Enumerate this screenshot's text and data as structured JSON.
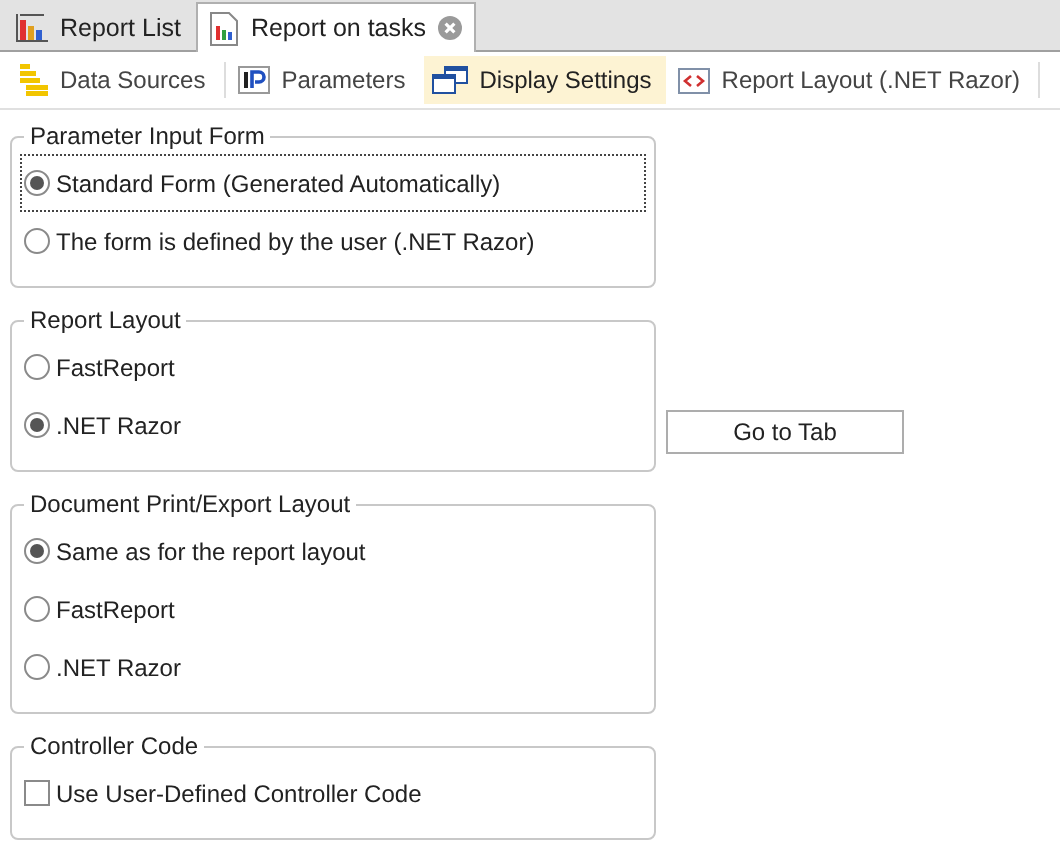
{
  "tabs": [
    {
      "label": "Report List",
      "kind": "list",
      "selected": false,
      "closable": false
    },
    {
      "label": "Report on tasks",
      "kind": "report",
      "selected": true,
      "closable": true
    }
  ],
  "toolbar": [
    {
      "label": "Data Sources",
      "kind": "data",
      "selected": false
    },
    {
      "label": "Parameters",
      "kind": "params",
      "selected": false
    },
    {
      "label": "Display Settings",
      "kind": "display",
      "selected": true
    },
    {
      "label": "Report Layout (.NET Razor)",
      "kind": "layout",
      "selected": false
    }
  ],
  "groups": [
    {
      "title": "Parameter Input Form",
      "options": [
        {
          "kind": "radio",
          "label": "Standard Form (Generated Automatically)",
          "selected": true,
          "focused": true
        },
        {
          "kind": "radio",
          "label": "The form is defined by the user (.NET Razor)",
          "selected": false,
          "focused": false
        }
      ]
    },
    {
      "title": "Report Layout",
      "action": "Go to Tab",
      "options": [
        {
          "kind": "radio",
          "label": "FastReport",
          "selected": false,
          "focused": false
        },
        {
          "kind": "radio",
          "label": ".NET Razor",
          "selected": true,
          "focused": false
        }
      ]
    },
    {
      "title": "Document Print/Export Layout",
      "options": [
        {
          "kind": "radio",
          "label": "Same as for the report layout",
          "selected": true,
          "focused": false
        },
        {
          "kind": "radio",
          "label": "FastReport",
          "selected": false,
          "focused": false
        },
        {
          "kind": "radio",
          "label": ".NET Razor",
          "selected": false,
          "focused": false
        }
      ]
    },
    {
      "title": "Controller Code",
      "options": [
        {
          "kind": "checkbox",
          "label": "Use User-Defined Controller Code",
          "checked": false,
          "focused": false
        }
      ]
    }
  ]
}
